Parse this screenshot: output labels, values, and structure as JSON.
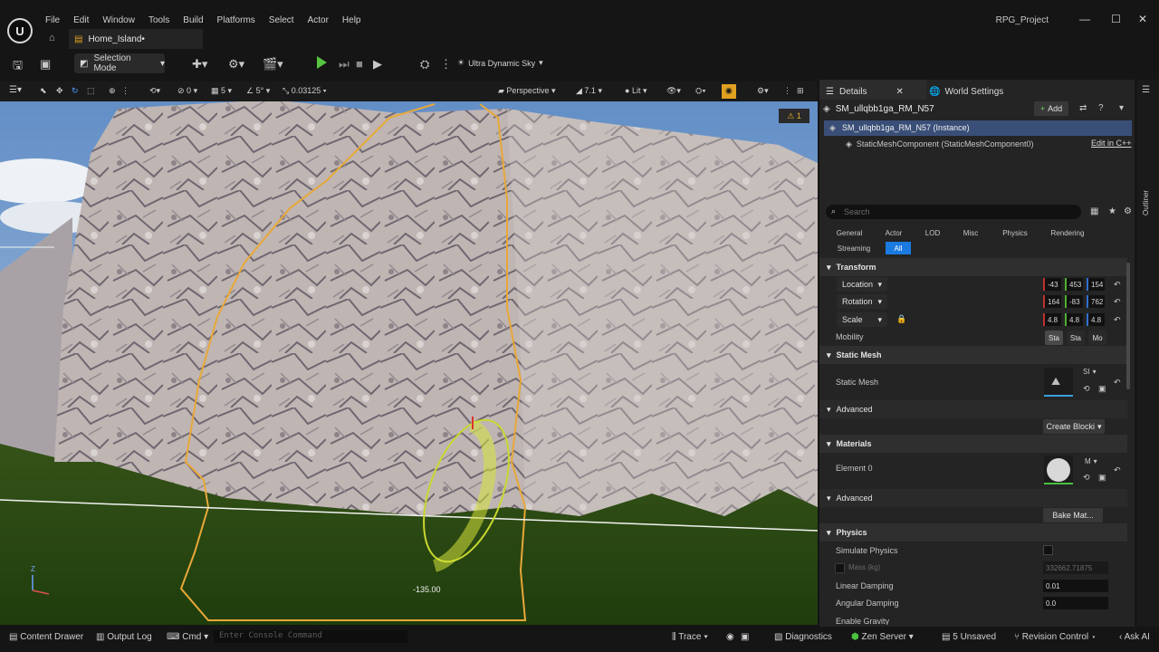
{
  "window": {
    "menu": [
      "File",
      "Edit",
      "Window",
      "Tools",
      "Build",
      "Platforms",
      "Select",
      "Actor",
      "Help"
    ],
    "project": "RPG_Project",
    "tab_label": "Home_Island•",
    "logo": "U"
  },
  "toolbar": {
    "selection_mode": "Selection Mode",
    "sky": "Ultra Dynamic Sky"
  },
  "viewport_toolbar": {
    "rot_snap": "0",
    "grid": "5",
    "angle": "5°",
    "scale_snap": "0.03125",
    "view": "Perspective",
    "fov": "7.1",
    "lit": "Lit",
    "warning": "⚠ 1"
  },
  "viewport": {
    "rotation_readout": "-135.00",
    "axis_z": "Z"
  },
  "panel": {
    "tab_details": "Details",
    "tab_world": "World Settings",
    "actor_name": "SM_ullqbb1ga_RM_N57",
    "add_label": "Add",
    "instance_label": "SM_ullqbb1ga_RM_N57 (Instance)",
    "component_label": "StaticMeshComponent (StaticMeshComponent0)",
    "edit_cpp": "Edit in C++",
    "search_placeholder": "Search",
    "categories": [
      "General",
      "Actor",
      "LOD",
      "Misc",
      "Physics",
      "Rendering",
      "Streaming",
      "All"
    ],
    "outliner": "Outliner"
  },
  "transform": {
    "title": "Transform",
    "location_label": "Location",
    "location": [
      "-43",
      "453",
      "154"
    ],
    "rotation_label": "Rotation",
    "rotation": [
      "164",
      "-83",
      "762"
    ],
    "scale_label": "Scale",
    "scale": [
      "4.8",
      "4.8",
      "4.8"
    ],
    "mobility_label": "Mobility",
    "mobility": [
      "Sta",
      "Sta",
      "Mo"
    ]
  },
  "static_mesh": {
    "title": "Static Mesh",
    "label": "Static Mesh",
    "dropdown": "SI",
    "advanced": "Advanced",
    "create_blocking": "Create Blocki"
  },
  "materials": {
    "title": "Materials",
    "element": "Element 0",
    "dropdown": "M",
    "advanced": "Advanced",
    "bake": "Bake Mat..."
  },
  "physics": {
    "title": "Physics",
    "simulate": "Simulate Physics",
    "mass_label": "Mass (kg)",
    "mass": "332662.71875",
    "linear_label": "Linear Damping",
    "linear": "0.01",
    "angular_label": "Angular Damping",
    "angular": "0.0",
    "gravity_label": "Enable Gravity"
  },
  "statusbar": {
    "content_drawer": "Content Drawer",
    "output_log": "Output Log",
    "cmd": "Cmd",
    "console_placeholder": "Enter Console Command",
    "trace": "Trace",
    "diagnostics": "Diagnostics",
    "zen": "Zen Server",
    "unsaved": "5 Unsaved",
    "revision": "Revision Control",
    "ask_ai": "Ask AI"
  },
  "colors": {
    "accent": "#e0a020",
    "selection_outline": "#e8a838",
    "panel_bg": "#242424",
    "active_filter": "#1a7ae0",
    "play_green": "#57c441"
  }
}
